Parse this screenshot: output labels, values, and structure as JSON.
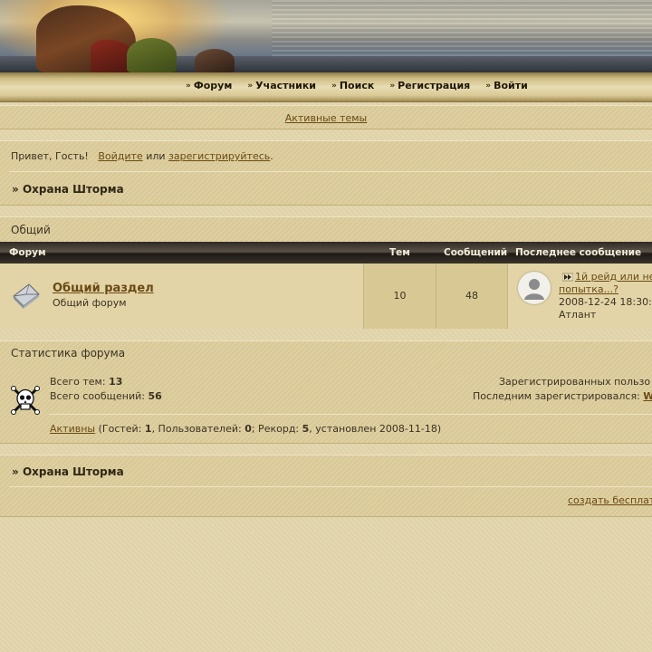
{
  "nav": {
    "items": [
      {
        "label": "Форум"
      },
      {
        "label": "Участники"
      },
      {
        "label": "Поиск"
      },
      {
        "label": "Регистрация"
      },
      {
        "label": "Войти"
      }
    ]
  },
  "active_topics": "Активные темы",
  "greeting": {
    "prefix": "Привет, Гость!",
    "login_link": "Войдите",
    "or": "или",
    "register_link": "зарегистрируйтесь",
    "suffix": "."
  },
  "breadcrumb": {
    "arrow": "»",
    "title": "Охрана Шторма"
  },
  "category": {
    "title": "Общий",
    "columns": {
      "forum": "Форум",
      "topics": "Тем",
      "posts": "Сообщений",
      "last_post": "Последнее сообщение"
    },
    "forums": [
      {
        "name": "Общий раздел",
        "description": "Общий форум",
        "topics": "10",
        "posts": "48",
        "last_post": {
          "title_line1": "1й рейд или не",
          "title_line2": "попытка...?",
          "date": "2008-12-24 18:30:",
          "author": "Атлант"
        }
      }
    ]
  },
  "stats": {
    "title": "Статистика форума",
    "total_topics_label": "Всего тем:",
    "total_topics": "13",
    "total_posts_label": "Всего сообщений:",
    "total_posts": "56",
    "registered_label": "Зарегистрированных пользо",
    "last_registered_label": "Последним зарегистрировался:",
    "last_registered_user": "W",
    "active_link": "Активны",
    "active_open": " (Гостей: ",
    "guests": "1",
    "users_label": ", Пользователей: ",
    "users": "0",
    "record_label": "; Рекорд: ",
    "record": "5",
    "record_suffix": ", установлен 2008-11-18)"
  },
  "footer": {
    "arrow": "»",
    "title": "Охрана Шторма",
    "create_link": "создать бесплат"
  }
}
